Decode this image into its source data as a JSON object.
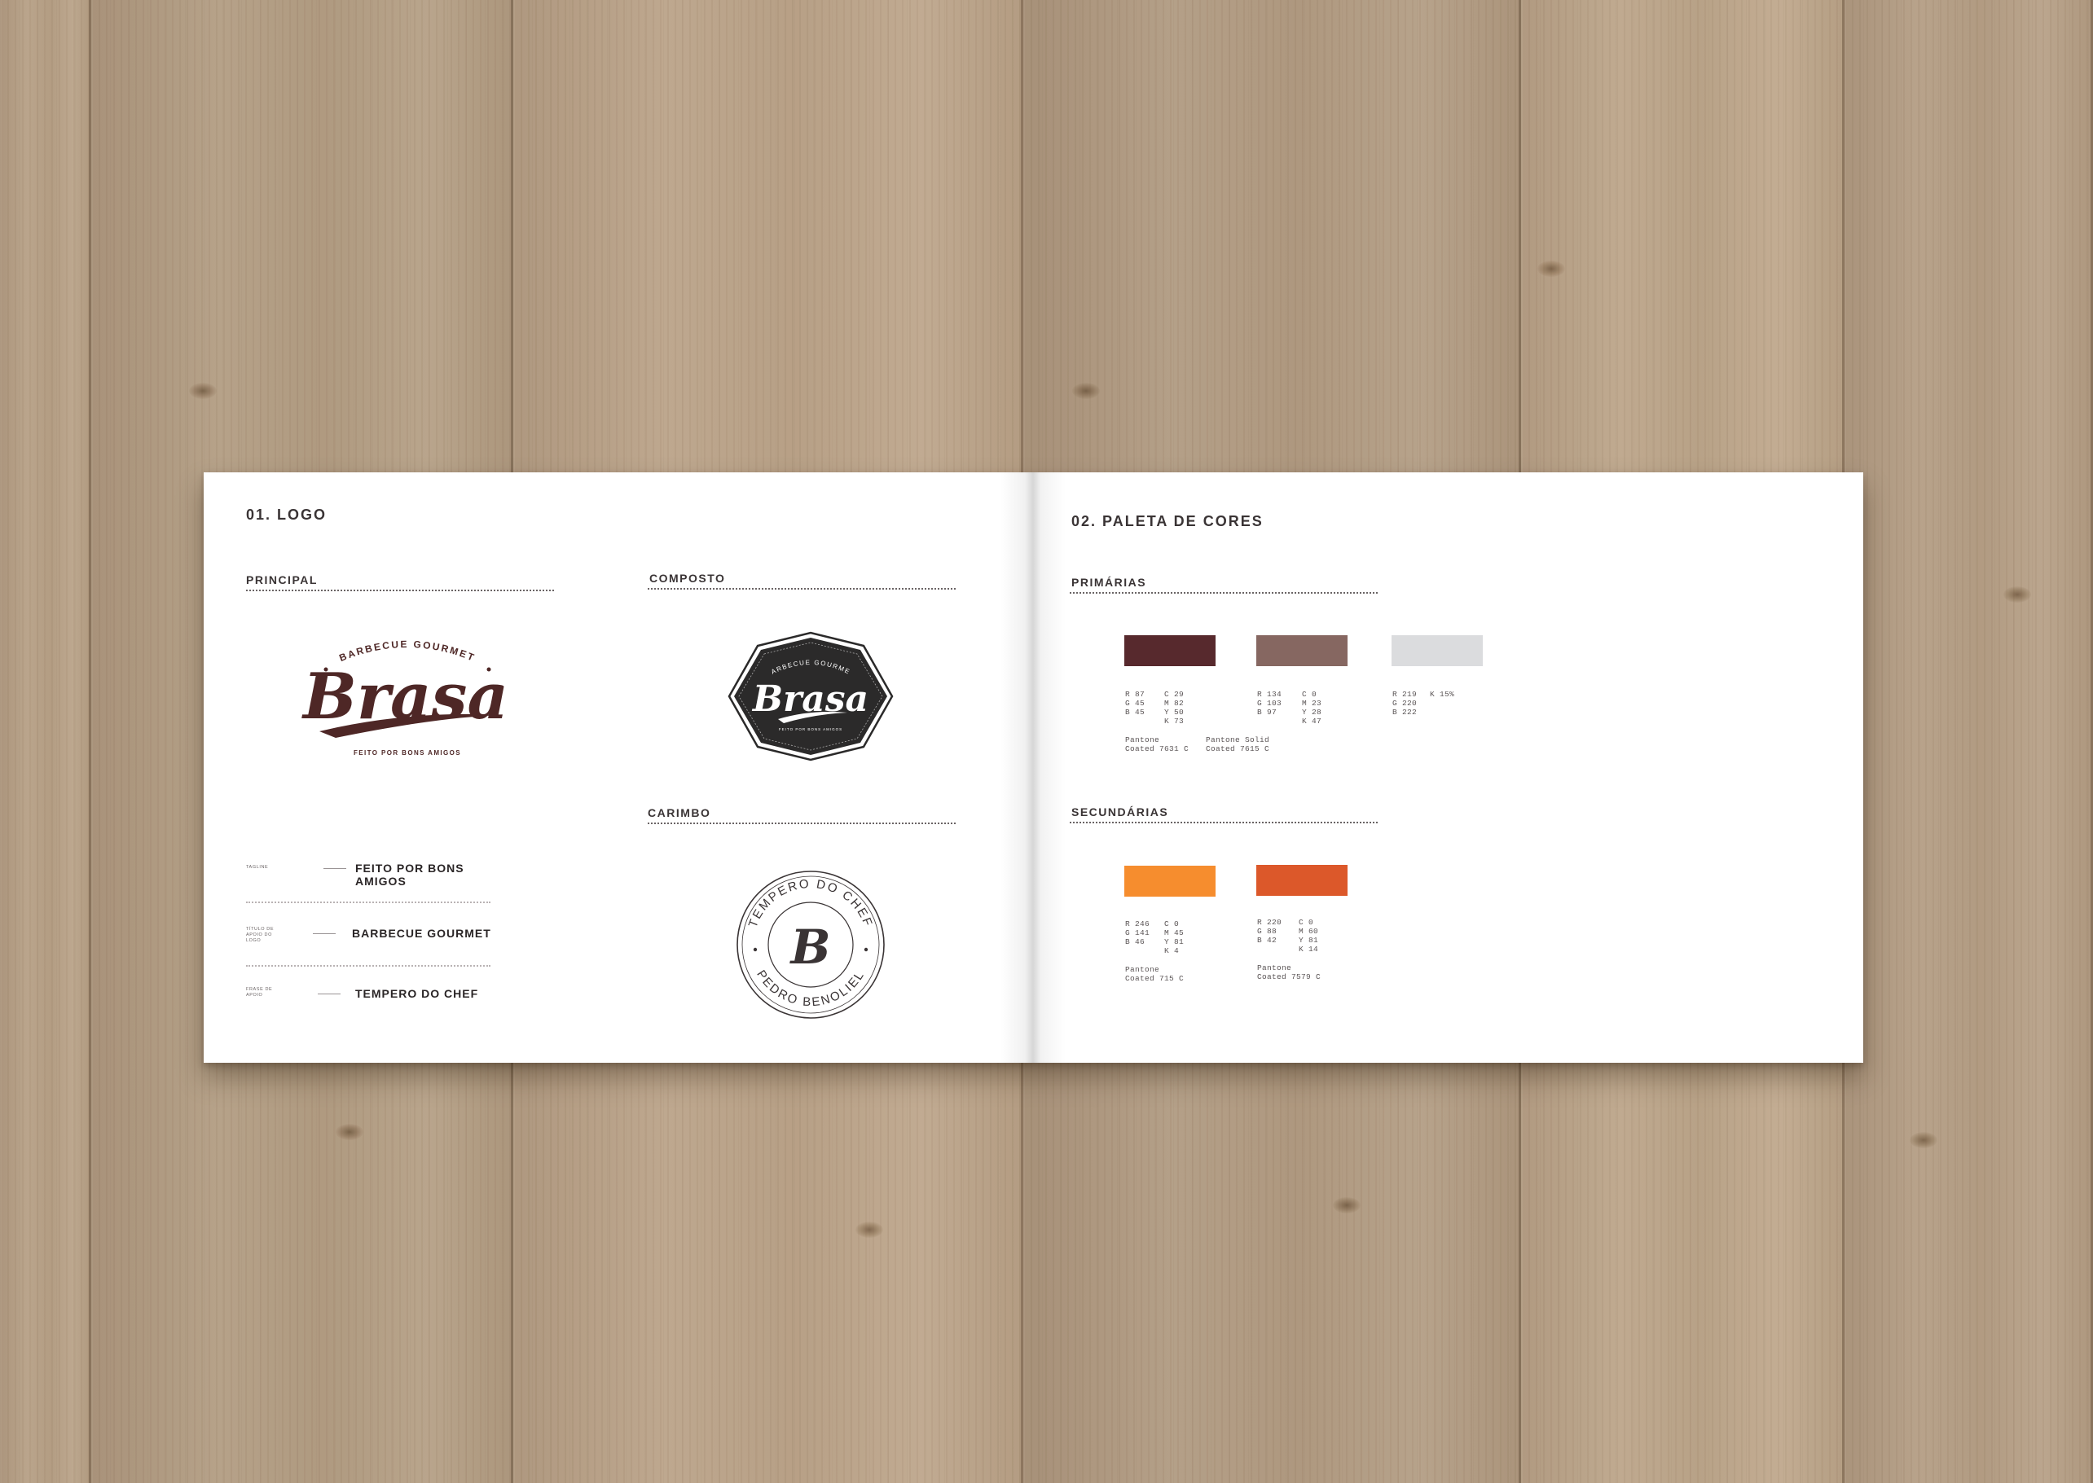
{
  "colors": {
    "brand_dark": "#4e2726",
    "badge_bg": "#2b2a2a",
    "wood": "#b49e85",
    "page": "#ffffff"
  },
  "left_page": {
    "heading": "01. LOGO",
    "principal_label": "PRINCIPAL",
    "composto_label": "COMPOSTO",
    "carimbo_label": "CARIMBO",
    "logo_principal": {
      "arc_text": "BARBECUE GOURMET",
      "wordmark": "Brasa",
      "tagline": "FEITO POR BONS AMIGOS"
    },
    "logo_composto": {
      "arc_text": "BARBECUE GOURMET",
      "wordmark": "Brasa",
      "tagline": "FEITO POR BONS AMIGOS"
    },
    "logo_carimbo": {
      "top_text": "TEMPERO DO CHEF",
      "bottom_text": "PEDRO BENOLIEL",
      "monogram": "B"
    },
    "applications": [
      {
        "small": "TAGLINE",
        "text": "FEITO POR BONS AMIGOS"
      },
      {
        "small": "TÍTULO DE APOIO DO LOGO",
        "text": "BARBECUE GOURMET"
      },
      {
        "small": "FRASE DE APOIO",
        "text": "TEMPERO DO CHEF"
      }
    ]
  },
  "right_page": {
    "heading": "02. PALETA DE CORES",
    "primarias_label": "PRIMÁRIAS",
    "secundarias_label": "SECUNDÁRIAS",
    "primarias": [
      {
        "hex": "#57292d",
        "rgb": "R 87\nG 45\nB 45",
        "cmyk": "C 29\nM 82\nY 50\nK 73",
        "pantone": "Pantone\nCoated 7631 C"
      },
      {
        "hex": "#866761",
        "rgb": "R 134\nG 103\nB 97",
        "cmyk": "C 0\nM 23\nY 28\nK 47",
        "pantone": "Pantone Solid\nCoated 7615 C"
      },
      {
        "hex": "#dbdcde",
        "rgb": "R 219\nG 220\nB 222",
        "cmyk": "K 15%",
        "pantone": ""
      }
    ],
    "secundarias": [
      {
        "hex": "#f68d2e",
        "rgb": "R 246\nG 141\nB 46",
        "cmyk": "C 0\nM 45\nY 81\nK 4",
        "pantone": "Pantone\nCoated 715 C"
      },
      {
        "hex": "#dc582a",
        "rgb": "R 220\nG 88\nB 42",
        "cmyk": "C 0\nM 60\nY 81\nK 14",
        "pantone": "Pantone\nCoated 7579 C"
      }
    ]
  }
}
